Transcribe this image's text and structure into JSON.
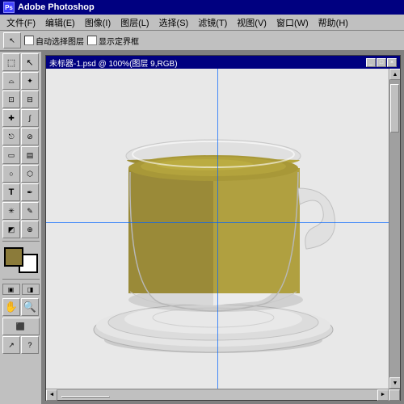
{
  "app": {
    "title": "Adobe Photoshop",
    "title_icon": "Ps"
  },
  "menubar": {
    "items": [
      {
        "label": "文件(F)",
        "id": "file"
      },
      {
        "label": "编辑(E)",
        "id": "edit"
      },
      {
        "label": "图像(I)",
        "id": "image"
      },
      {
        "label": "图层(L)",
        "id": "layer"
      },
      {
        "label": "选择(S)",
        "id": "select"
      },
      {
        "label": "滤镜(T)",
        "id": "filter"
      },
      {
        "label": "视图(V)",
        "id": "view"
      },
      {
        "label": "窗口(W)",
        "id": "window"
      },
      {
        "label": "帮助(H)",
        "id": "help"
      }
    ]
  },
  "options_bar": {
    "auto_select_label": "自动选择图层",
    "show_bounds_label": "显示定界框"
  },
  "document": {
    "title": "未标器-1.psd @ 100%(图层 9,RGB)",
    "min_btn": "_",
    "max_btn": "□",
    "close_btn": "×"
  },
  "tools": [
    {
      "id": "move",
      "icon": "↖",
      "label": "Move"
    },
    {
      "id": "marquee",
      "icon": "⬚",
      "label": "Marquee"
    },
    {
      "id": "lasso",
      "icon": "⌓",
      "label": "Lasso"
    },
    {
      "id": "magic-wand",
      "icon": "✦",
      "label": "Magic Wand"
    },
    {
      "id": "crop",
      "icon": "⊡",
      "label": "Crop"
    },
    {
      "id": "slice",
      "icon": "⊟",
      "label": "Slice"
    },
    {
      "id": "heal",
      "icon": "✚",
      "label": "Heal"
    },
    {
      "id": "brush",
      "icon": "∫",
      "label": "Brush"
    },
    {
      "id": "clone",
      "icon": "⎋",
      "label": "Clone"
    },
    {
      "id": "history",
      "icon": "⊘",
      "label": "History"
    },
    {
      "id": "eraser",
      "icon": "▭",
      "label": "Eraser"
    },
    {
      "id": "gradient",
      "icon": "▤",
      "label": "Gradient"
    },
    {
      "id": "dodge",
      "icon": "○",
      "label": "Dodge"
    },
    {
      "id": "path",
      "icon": "⬡",
      "label": "Path"
    },
    {
      "id": "type",
      "icon": "T",
      "label": "Type"
    },
    {
      "id": "pen",
      "icon": "✒",
      "label": "Pen"
    },
    {
      "id": "shape",
      "icon": "▭",
      "label": "Shape"
    },
    {
      "id": "notes",
      "icon": "✎",
      "label": "Notes"
    },
    {
      "id": "eyedropper",
      "icon": "◩",
      "label": "Eyedropper"
    },
    {
      "id": "hand",
      "icon": "✋",
      "label": "Hand"
    },
    {
      "id": "zoom",
      "icon": "⊕",
      "label": "Zoom"
    }
  ],
  "colors": {
    "foreground": "#8B7B3A",
    "background": "#ffffff",
    "canvas_bg": "#e8e8e8",
    "guide_color": "rgba(0,100,255,0.7)",
    "titlebar_active": "#000080",
    "app_bg": "#c0c0c0"
  }
}
